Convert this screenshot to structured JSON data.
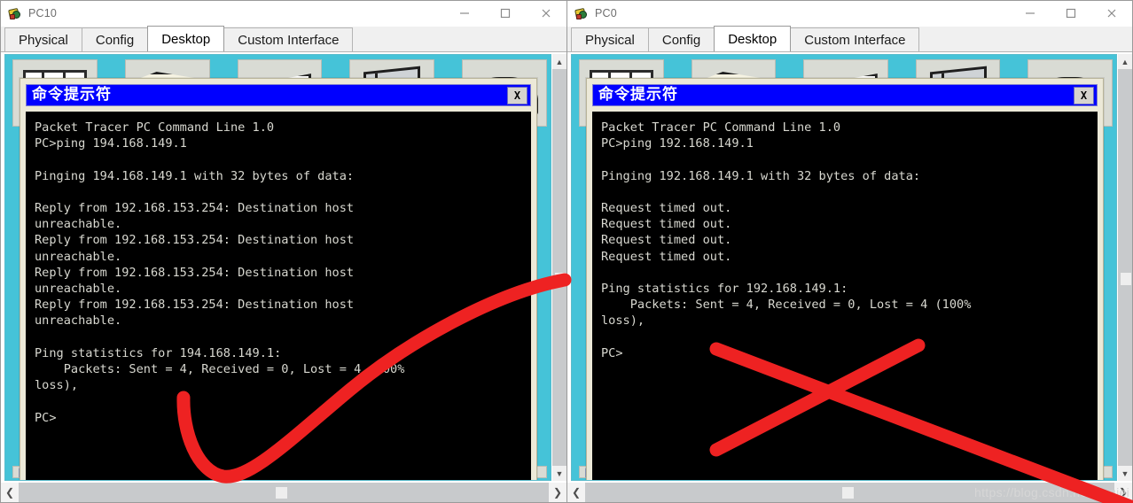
{
  "windows": [
    {
      "id": "pc10",
      "title": "PC10",
      "app_icon": "packet-tracer-icon",
      "controls": {
        "minimize": "minimize-icon",
        "maximize": "maximize-icon",
        "close": "close-icon"
      },
      "tabs": [
        {
          "label": "Physical",
          "active": false
        },
        {
          "label": "Config",
          "active": false
        },
        {
          "label": "Desktop",
          "active": true
        },
        {
          "label": "Custom Interface",
          "active": false
        }
      ],
      "cmd": {
        "title": "命令提示符",
        "close_label": "X",
        "text": "Packet Tracer PC Command Line 1.0\nPC>ping 194.168.149.1\n\nPinging 194.168.149.1 with 32 bytes of data:\n\nReply from 192.168.153.254: Destination host\nunreachable.\nReply from 192.168.153.254: Destination host\nunreachable.\nReply from 192.168.153.254: Destination host\nunreachable.\nReply from 192.168.153.254: Destination host\nunreachable.\n\nPing statistics for 194.168.149.1:\n    Packets: Sent = 4, Received = 0, Lost = 4 (100%\nloss),\n\nPC>"
      },
      "annotation": "red-check-mark"
    },
    {
      "id": "pc0",
      "title": "PC0",
      "app_icon": "packet-tracer-icon",
      "controls": {
        "minimize": "minimize-icon",
        "maximize": "maximize-icon",
        "close": "close-icon"
      },
      "tabs": [
        {
          "label": "Physical",
          "active": false
        },
        {
          "label": "Config",
          "active": false
        },
        {
          "label": "Desktop",
          "active": true
        },
        {
          "label": "Custom Interface",
          "active": false
        }
      ],
      "cmd": {
        "title": "命令提示符",
        "close_label": "X",
        "text": "Packet Tracer PC Command Line 1.0\nPC>ping 192.168.149.1\n\nPinging 192.168.149.1 with 32 bytes of data:\n\nRequest timed out.\nRequest timed out.\nRequest timed out.\nRequest timed out.\n\nPing statistics for 192.168.149.1:\n    Packets: Sent = 4, Received = 0, Lost = 4 (100%\nloss),\n\nPC>"
      },
      "annotation": "red-cross-mark"
    }
  ],
  "watermark": "https://blog.csdn.net/beqiei",
  "colors": {
    "cmd_title_bar": "#0000ff",
    "cmd_background": "#000000",
    "cmd_text": "#d8d8d0",
    "desktop": "#45c3d8",
    "annotation_red": "#ee2222",
    "dialog_face": "#ece9d8"
  }
}
